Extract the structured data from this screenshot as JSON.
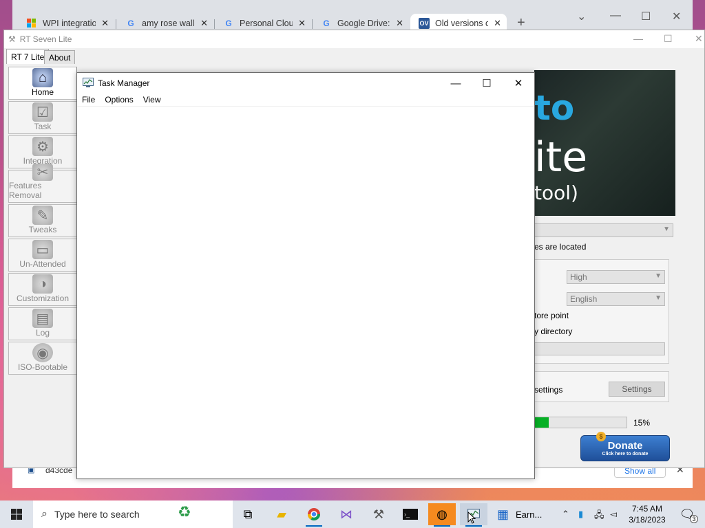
{
  "browser": {
    "tabs": [
      {
        "title": "WPI integratio",
        "favicon": "windows-logo-icon",
        "active": false
      },
      {
        "title": "amy rose wallp",
        "favicon": "google-g-icon",
        "active": false
      },
      {
        "title": "Personal Clou",
        "favicon": "google-g-icon",
        "active": false
      },
      {
        "title": "Google Drive:",
        "favicon": "google-g-icon",
        "active": false
      },
      {
        "title": "Old versions o",
        "favicon": "ov-icon",
        "active": true
      }
    ],
    "new_tab": "+",
    "download_item": "d43cde",
    "show_all": "Show all"
  },
  "rt_app": {
    "title": "RT Seven Lite",
    "tabs": [
      "RT 7 Lite",
      "About"
    ],
    "sidebar": [
      {
        "label": "Home",
        "icon": "home-icon",
        "active": true
      },
      {
        "label": "Task",
        "icon": "task-icon",
        "active": false
      },
      {
        "label": "Integration",
        "icon": "integration-icon",
        "active": false
      },
      {
        "label": "Features Removal",
        "icon": "features-removal-icon",
        "active": false
      },
      {
        "label": "Tweaks",
        "icon": "tweaks-icon",
        "active": false
      },
      {
        "label": "Un-Attended",
        "icon": "unattended-icon",
        "active": false
      },
      {
        "label": "Customization",
        "icon": "customization-icon",
        "active": false
      },
      {
        "label": "Log",
        "icon": "log-icon",
        "active": false
      },
      {
        "label": "ISO-Bootable",
        "icon": "iso-bootable-icon",
        "active": false
      }
    ],
    "banner": {
      "line1": "to",
      "line2": "ite",
      "line3": "tool)"
    },
    "path_label": "es are located",
    "priority_value": "High",
    "language_value": "English",
    "restore_point_label": "tore point",
    "directory_label": "y directory",
    "settings_label": "settings",
    "settings_button": "Settings",
    "progress_percent": "15%",
    "progress_value": 0.15,
    "donate_title": "Donate",
    "donate_sub": "Click here to donate"
  },
  "task_manager": {
    "title": "Task Manager",
    "menu": [
      "File",
      "Options",
      "View"
    ]
  },
  "taskbar": {
    "search_placeholder": "Type here to search",
    "pinned_label": "Earn...",
    "time": "7:45 AM",
    "date": "3/18/2023",
    "notification_count": "3"
  },
  "colors": {
    "accent": "#0067c0",
    "donate_blue": "#2a62b4",
    "banner_blue": "#29a8e0"
  }
}
